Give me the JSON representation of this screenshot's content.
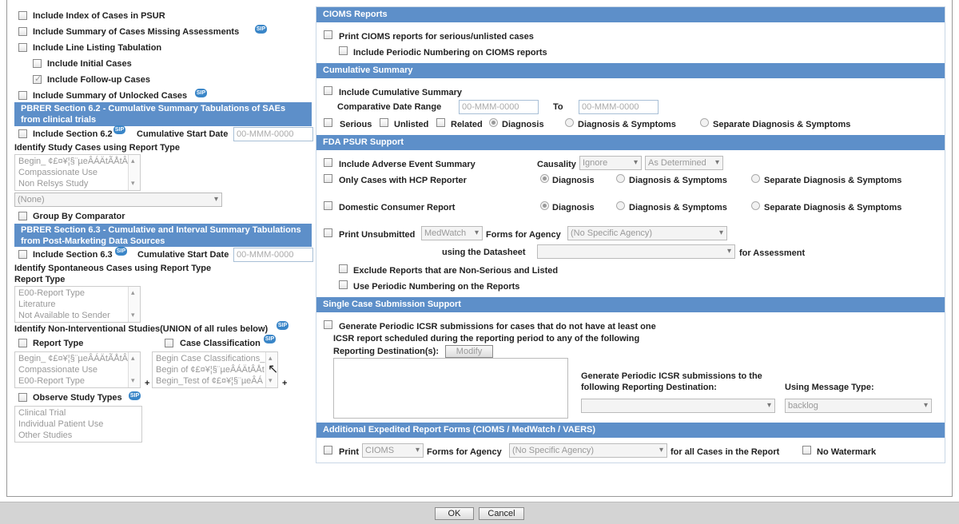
{
  "left": {
    "index_cases": "Include Index of Cases in PSUR",
    "summary_missing": "Include Summary of Cases Missing Assessments",
    "line_listing": "Include Line Listing Tabulation",
    "initial_cases": "Include Initial Cases",
    "followup_cases": "Include Follow-up Cases",
    "summary_unlocked": "Include Summary of Unlocked Cases",
    "sip_badge": "SIP",
    "pbrer62": "PBRER Section 6.2 - Cumulative Summary Tabulations of SAEs from clinical trials",
    "include_62": "Include Section 6.2",
    "cum_start": "Cumulative Start Date",
    "date_placeholder": "00-MMM-0000",
    "identify_study": "Identify Study Cases using Report Type",
    "study_list": [
      "Begin_ ¢£¤¥¦§¨µeÂÁÄtÃÅtÂ",
      "Compassionate Use",
      "Non Relsys Study"
    ],
    "none_option": "(None)",
    "group_comparator": "Group By Comparator",
    "pbrer63": "PBRER Section 6.3 - Cumulative and Interval Summary Tabulations from Post-Marketing Data Sources",
    "include_63": "Include Section 6.3",
    "identify_spont": "Identify Spontaneous Cases using Report Type",
    "report_type_label": "Report Type",
    "spont_list": [
      "E00-Report Type",
      "Literature",
      "Not Available to Sender"
    ],
    "identify_nonint": "Identify Non-Interventional Studies(UNION of all rules below)",
    "report_type": "Report Type",
    "case_classification": "Case Classification",
    "rt_list": [
      "Begin_ ¢£¤¥¦§¨µeÂÁÄtÃÅtÂ",
      "Compassionate Use",
      "E00-Report Type"
    ],
    "cc_list": [
      "Begin Case Classifications_",
      "Begin of ¢£¤¥¦§¨µeÂÁÄtÂÅt",
      "Begin_Test of ¢£¤¥¦§¨µeÂÁ"
    ],
    "plus": "+",
    "observe_types": "Observe Study Types",
    "observe_list": [
      "Clinical Trial",
      "Individual Patient Use",
      "Other Studies"
    ]
  },
  "cioms": {
    "header": "CIOMS Reports",
    "print_serious": "Print CIOMS reports for serious/unlisted cases",
    "periodic_numbering": "Include Periodic Numbering on CIOMS reports"
  },
  "cumulative": {
    "header": "Cumulative Summary",
    "include": "Include Cumulative Summary",
    "comparative_range": "Comparative Date Range",
    "to": "To",
    "date_placeholder": "00-MMM-0000",
    "serious": "Serious",
    "unlisted": "Unlisted",
    "related": "Related",
    "diagnosis": "Diagnosis",
    "diag_symptoms": "Diagnosis & Symptoms",
    "sep_diag_symptoms": "Separate Diagnosis & Symptoms"
  },
  "fda": {
    "header": "FDA PSUR Support",
    "include_ae_summary": "Include Adverse Event Summary",
    "causality": "Causality",
    "ignore": "Ignore",
    "as_determined": "As Determined",
    "hcp_only": "Only Cases with HCP Reporter",
    "diagnosis": "Diagnosis",
    "diag_symptoms": "Diagnosis & Symptoms",
    "sep_diag_symptoms": "Separate Diagnosis & Symptoms",
    "domestic_consumer": "Domestic Consumer Report",
    "print_unsubmitted": "Print Unsubmitted",
    "medwatch": "MedWatch",
    "forms_for_agency": "Forms for Agency",
    "no_specific_agency": "(No Specific Agency)",
    "using_datasheet": "using the Datasheet",
    "for_assessment": "for Assessment",
    "exclude_nonserious": "Exclude Reports that are Non-Serious and Listed",
    "use_periodic": "Use Periodic Numbering on the Reports"
  },
  "single": {
    "header": "Single Case Submission Support",
    "generate_line1": "Generate Periodic ICSR submissions for cases that do not have at least one",
    "generate_line2": "ICSR report scheduled during the reporting period to any of the following",
    "reporting_dest": "Reporting Destination(s):",
    "modify": "Modify",
    "gen_to_line1": "Generate Periodic ICSR submissions to the",
    "gen_to_line2": "following Reporting Destination:",
    "using_msg_type": "Using Message Type:",
    "msg_type_value": "backlog"
  },
  "additional": {
    "header": "Additional Expedited Report Forms (CIOMS / MedWatch / VAERS)",
    "print": "Print",
    "cioms": "CIOMS",
    "forms_for_agency": "Forms for Agency",
    "no_specific_agency": "(No Specific Agency)",
    "for_all_cases": "for all Cases in the Report",
    "no_watermark": "No Watermark"
  },
  "footer": {
    "ok": "OK",
    "cancel": "Cancel"
  }
}
